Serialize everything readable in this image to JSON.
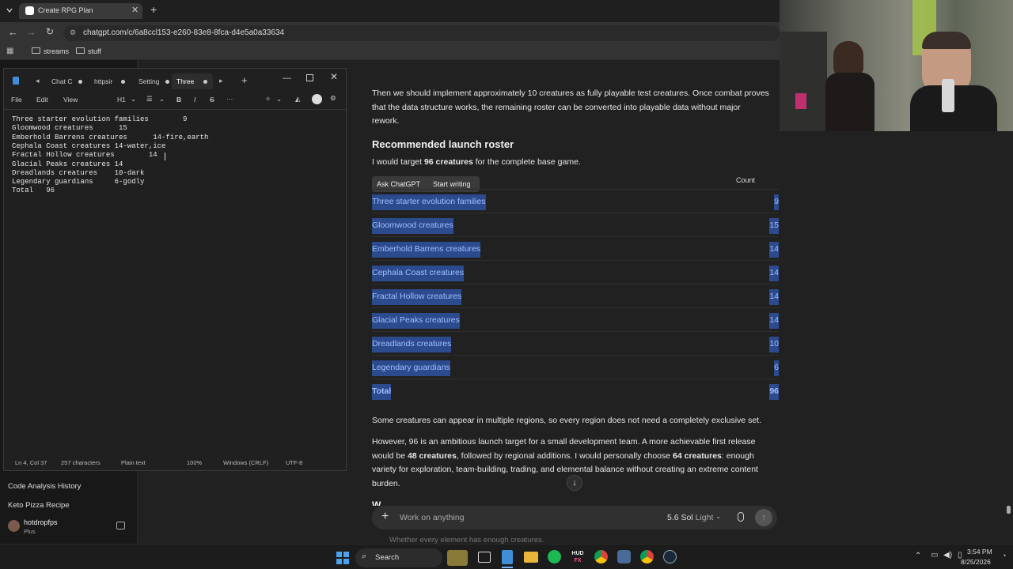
{
  "browser": {
    "tab_title": "Create RPG Plan",
    "url": "chatgpt.com/c/6a8ccl153-e260-83e8-8fca-d4e5a0a33634",
    "bookmarks": [
      "streams",
      "stuff"
    ]
  },
  "sidebar": {
    "items": [
      "Code Analysis History",
      "Keto Pizza Recipe"
    ],
    "user": {
      "name": "hotdropfps",
      "plan": "Plus"
    }
  },
  "chat": {
    "intro": [
      "Then we should implement approximately 10 creatures as fully playable test creatures. Once combat proves",
      "that the data structure works, the remaining roster can be converted into playable data without major",
      "rework."
    ],
    "heading": "Recommended launch roster",
    "target_prefix": "I would target ",
    "target_bold": "96 creatures",
    "target_suffix": " for the complete base game.",
    "popup": {
      "ask": "Ask ChatGPT",
      "write": "Start writing"
    },
    "table": {
      "count_header": "Count",
      "rows": [
        {
          "label": "Three starter evolution families",
          "count": "9"
        },
        {
          "label": "Gloomwood creatures",
          "count": "15"
        },
        {
          "label": "Emberhold Barrens creatures",
          "count": "14"
        },
        {
          "label": "Cephala Coast creatures",
          "count": "14"
        },
        {
          "label": "Fractal Hollow creatures",
          "count": "14"
        },
        {
          "label": "Glacial Peaks creatures",
          "count": "14"
        },
        {
          "label": "Dreadlands creatures",
          "count": "10"
        },
        {
          "label": "Legendary guardians",
          "count": "6"
        },
        {
          "label": "Total",
          "count": "96"
        }
      ]
    },
    "para2": "Some creatures can appear in multiple regions, so every region does not need a completely exclusive set.",
    "para3": {
      "l1": "However, 96 is an ambitious launch target for a small development team. A more achievable first release",
      "l2a": "would be ",
      "l2b": "48 creatures",
      "l2c": ", followed by regional additions. I would personally choose ",
      "l2d": "64 creatures",
      "l2e": ": enough",
      "l3": "variety for exploration, team-building, trading, and elemental balance without creating an extreme content",
      "l4": "burden."
    },
    "cut_heading": "W",
    "cut_bullet": "Whether every element has enough creatures."
  },
  "composer": {
    "placeholder": "Work on anything",
    "model": "5.6 Sol",
    "mode": "Light"
  },
  "notepad": {
    "tabs": [
      "Chat C",
      "httpsir",
      "Setting",
      "Three"
    ],
    "menu": [
      "File",
      "Edit",
      "View"
    ],
    "heading_btn": "H1",
    "lines": [
      "Three starter evolution families        9",
      "Gloomwood creatures      15",
      "Emberhold Barrens creatures      14-fire,earth",
      "Cephala Coast creatures 14-water,ice",
      "Fractal Hollow creatures        14",
      "Glacial Peaks creatures 14",
      "Dreadlands creatures    10-dark",
      "Legendary guardians     6-godly",
      "Total   96"
    ],
    "status": {
      "position": "Ln 4, Col 37",
      "chars": "257 characters",
      "format": "Plain text",
      "zoom": "100%",
      "eol": "Windows (CRLF)",
      "encoding": "UTF-8"
    }
  },
  "taskbar": {
    "search": "Search",
    "time": "3:54 PM",
    "date": "8/25/2026"
  }
}
